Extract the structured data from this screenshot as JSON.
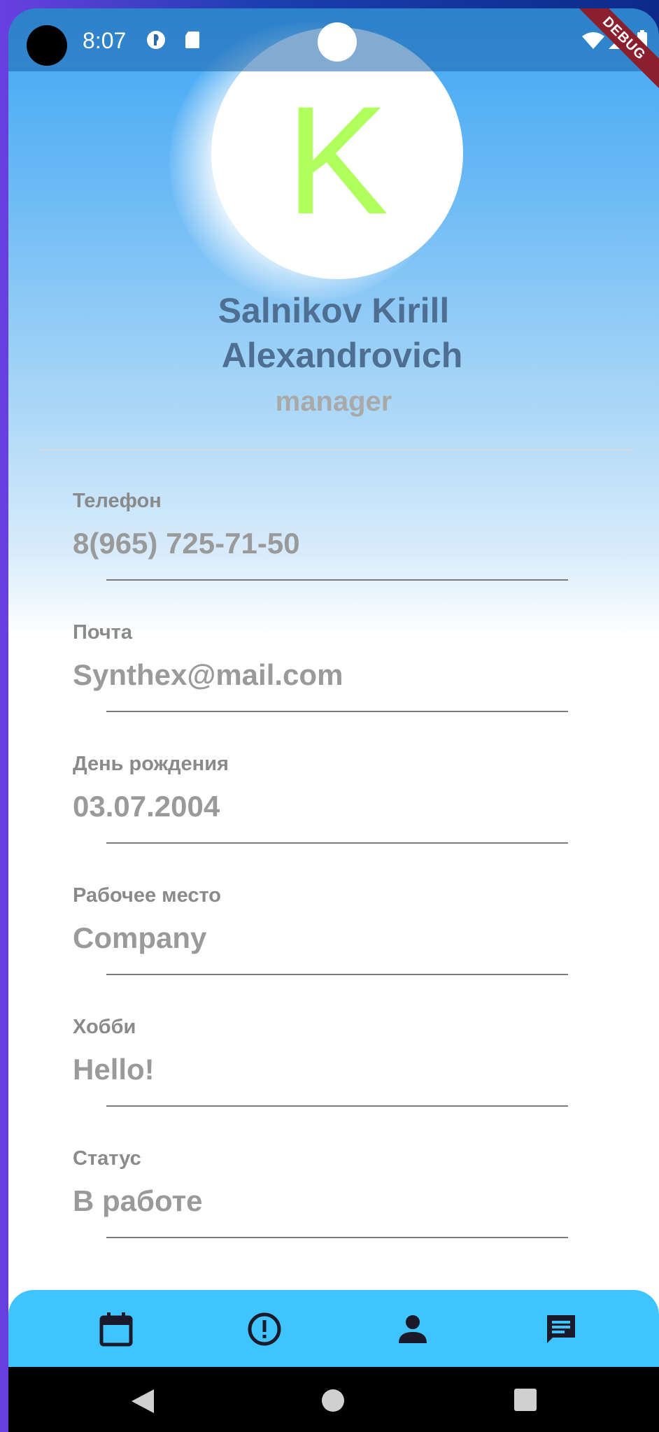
{
  "status_bar": {
    "time": "8:07",
    "debug_banner": "DEBUG"
  },
  "profile": {
    "avatar_letter": "K",
    "name_line1": "Salnikov Kirill",
    "name_line2": "Alexandrovich",
    "role": "manager"
  },
  "fields": [
    {
      "label": "Телефон",
      "value": "8(965) 725-71-50"
    },
    {
      "label": "Почта",
      "value": "Synthex@mail.com"
    },
    {
      "label": "День рождения",
      "value": "03.07.2004"
    },
    {
      "label": "Рабочее место",
      "value": "Company"
    },
    {
      "label": "Хобби",
      "value": "Hello!"
    },
    {
      "label": "Статус",
      "value": "В работе"
    }
  ],
  "bottom_nav": {
    "items": [
      "calendar-icon",
      "alert-icon",
      "person-icon",
      "chat-icon"
    ]
  },
  "colors": {
    "avatar_letter": "#b0ff5c",
    "name": "#4e6f92",
    "bottom_nav": "#40c4ff"
  }
}
